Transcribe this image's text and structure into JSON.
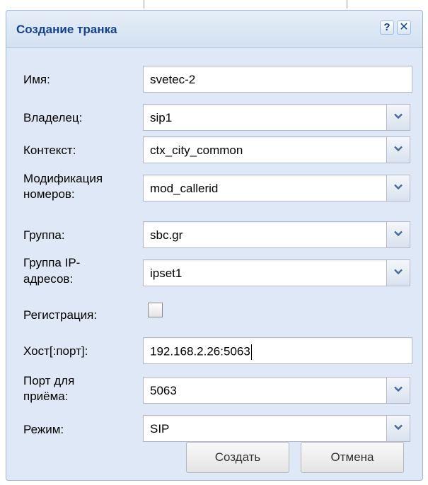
{
  "dialog": {
    "title": "Создание транка",
    "help_icon": "?",
    "close_icon": "✕"
  },
  "form": {
    "name": {
      "label": "Имя:",
      "value": "svetec-2"
    },
    "owner": {
      "label": "Владелец:",
      "value": "sip1"
    },
    "context": {
      "label": "Контекст:",
      "value": "ctx_city_common"
    },
    "modification": {
      "label_line1": "Модификация",
      "label_line2": "номеров:",
      "value": "mod_callerid"
    },
    "group": {
      "label": "Группа:",
      "value": "sbc.gr"
    },
    "ip_group": {
      "label_line1": "Группа IP-",
      "label_line2": "адресов:",
      "value": "ipset1"
    },
    "registration": {
      "label": "Регистрация:",
      "checked": false
    },
    "host": {
      "label": "Хост[:порт]:",
      "value": "192.168.2.26:5063"
    },
    "receive_port": {
      "label_line1": "Порт для",
      "label_line2": "приёма:",
      "value": "5063"
    },
    "mode": {
      "label": "Режим:",
      "value": "SIP"
    }
  },
  "buttons": {
    "create": "Создать",
    "cancel": "Отмена"
  },
  "icons": {
    "dropdown": "chevron-down-icon"
  },
  "colors": {
    "title_text": "#15428b",
    "dialog_background": "#dfe8f6",
    "field_border": "#b5b8c8"
  }
}
